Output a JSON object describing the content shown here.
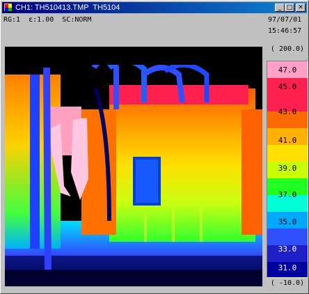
{
  "window": {
    "title": "CH1: TH510413.TMP  TH5104",
    "buttons": {
      "minimize": "_",
      "maximize": "□",
      "close": "✕"
    }
  },
  "status": {
    "settings": "RG:1  ε:1.00  SC:NORM",
    "date": "97/07/01",
    "time": "15:46:57"
  },
  "scale": {
    "max": "( 200.0)",
    "min": "( -10.0)",
    "labels": [
      "47.0",
      "45.0",
      "43.0",
      "41.0",
      "39.0",
      "37.0",
      "35.0",
      "33.0",
      "31.0"
    ]
  },
  "colors": {
    "palette": [
      "#ffffff",
      "#ff9ec0",
      "#ff2050",
      "#ff6a00",
      "#ffd000",
      "#b8ff00",
      "#10ff10",
      "#00ffe0",
      "#00a8ff",
      "#3050ff",
      "#2020d0",
      "#0000a0",
      "#000050",
      "#000000"
    ]
  },
  "image": {
    "icon": "thermal-image"
  }
}
